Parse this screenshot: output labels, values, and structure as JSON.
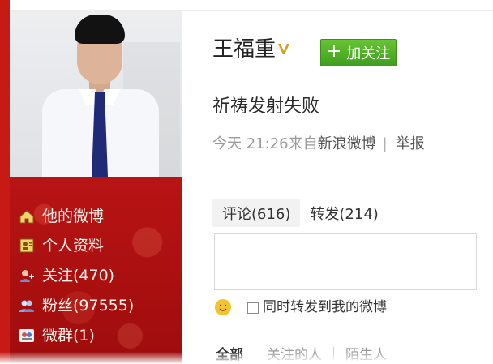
{
  "profile": {
    "name": "王福重",
    "follow_button_label": "加关注",
    "post_text": "祈祷发射失败",
    "meta": {
      "time": "今天 21:26",
      "source_prefix": "来自",
      "source": "新浪微博",
      "separator": "|",
      "report": "举报"
    },
    "tabs": [
      {
        "label": "评论(616)"
      },
      {
        "label": "转发(214)"
      }
    ],
    "share_checkbox_label": "同时转发到我的微博",
    "filters": [
      {
        "label": "全部"
      },
      {
        "label": "关注的人"
      },
      {
        "label": "陌生人"
      }
    ]
  },
  "sidebar": {
    "items": [
      {
        "label": "他的微博",
        "icon": "home-icon"
      },
      {
        "label": "个人资料",
        "icon": "profile-card-icon"
      },
      {
        "label": "关注(470)",
        "icon": "follow-user-icon"
      },
      {
        "label": "粉丝(97555)",
        "icon": "fans-icon"
      },
      {
        "label": "微群(1)",
        "icon": "group-icon"
      }
    ]
  },
  "colors": {
    "sidebar_red": "#a90f0f",
    "accent_red": "#c81a14",
    "button_green": "#4caf2a",
    "verify_gold": "#d4a017"
  }
}
